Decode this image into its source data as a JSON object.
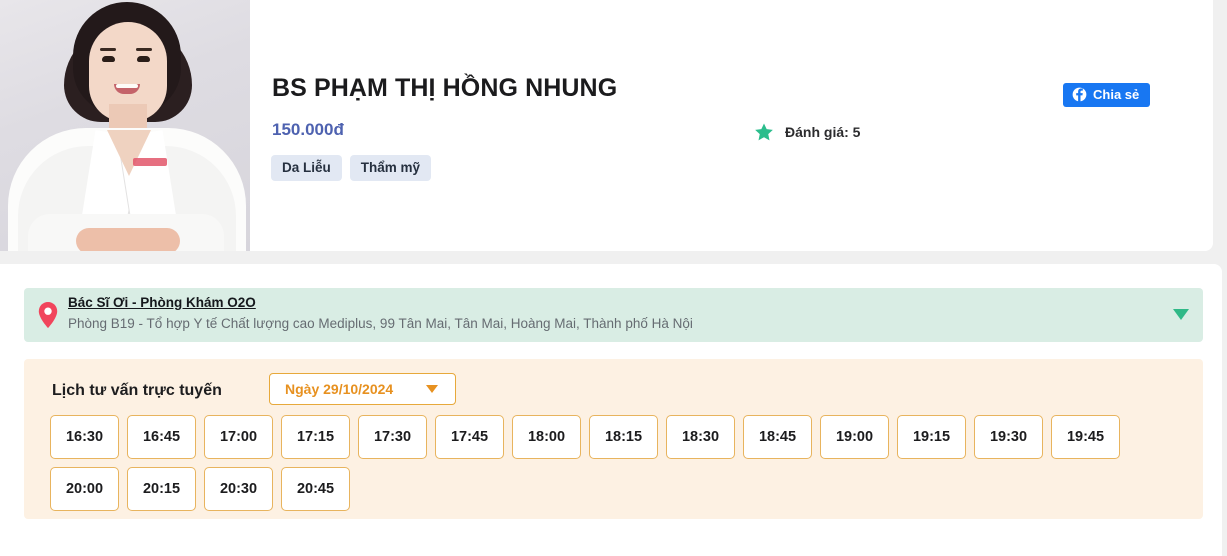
{
  "profile": {
    "photo_alt": "doctor-portrait",
    "name": "BS PHẠM THỊ HỒNG NHUNG",
    "price": "150.000đ",
    "tags": [
      "Da Liễu",
      "Thẩm mỹ"
    ],
    "rating_text": "Đánh giá: 5",
    "rating_value": 5,
    "star_icon": "star-icon",
    "star_color": "#2bbd8c"
  },
  "share": {
    "label": "Chia sẻ",
    "icon": "facebook-icon",
    "color": "#1877f2"
  },
  "clinic": {
    "pin_icon": "map-pin-icon",
    "name": "Bác Sĩ Ơi - Phòng Khám O2O",
    "address": "Phòng B19 - Tổ hợp Y tế Chất lượng cao Mediplus, 99 Tân Mai, Tân Mai, Hoàng Mai, Thành phố Hà Nội",
    "chevron_icon": "chevron-down-icon",
    "chevron_color": "#30b987",
    "background": "#d9ede4"
  },
  "schedule": {
    "title": "Lịch tư vấn trực tuyến",
    "date_label": "Ngày 29/10/2024",
    "date_caret_icon": "caret-down-icon",
    "accent_color": "#e79120",
    "panel_background": "#fdf1e3",
    "slots": [
      "16:30",
      "16:45",
      "17:00",
      "17:15",
      "17:30",
      "17:45",
      "18:00",
      "18:15",
      "18:30",
      "18:45",
      "19:00",
      "19:15",
      "19:30",
      "19:45",
      "20:00",
      "20:15",
      "20:30",
      "20:45"
    ]
  }
}
